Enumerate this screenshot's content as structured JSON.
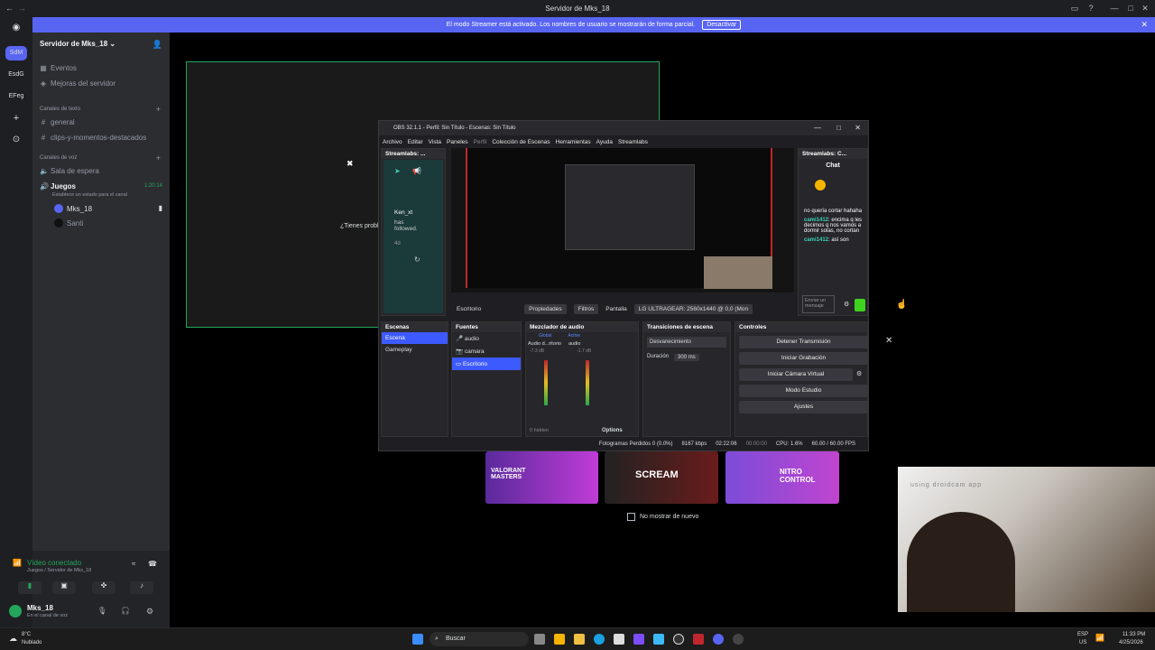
{
  "window": {
    "title": "Servidor de Mks_18"
  },
  "banner": {
    "text": "El modo Streamer está activado. Los nombres de usuario se mostrarán de forma parcial.",
    "button": "Desactivar"
  },
  "guilds": [
    "SdM",
    "EsdG",
    "EFeg"
  ],
  "sidebar": {
    "server_name": "Servidor de Mks_18",
    "events": "Eventos",
    "boosts": "Mejoras del servidor",
    "text_category": "Canales de texto",
    "text_channels": [
      "general",
      "clips-y-momentos-destacados"
    ],
    "voice_category": "Canales de voz",
    "voice_channels": [
      "Sala de espera"
    ],
    "active_voice": {
      "name": "Juegos",
      "time": "1:20:14",
      "status": "Establece un estado para el canal",
      "users": [
        "Mks_18",
        "Santi"
      ]
    }
  },
  "voice_panel": {
    "status": "Vídeo conectado",
    "location": "Juegos / Servidor de Mks_18"
  },
  "user_panel": {
    "name": "Mks_18",
    "status": "En el canal de voz"
  },
  "stream_preview": {
    "prompt": "¿Tienes probl",
    "dont_show": "No mostrar de nuevo"
  },
  "obs": {
    "title": "OBS 32.1.1 - Perfil: Sin Título - Escenas: Sin Título",
    "menu": [
      "Archivo",
      "Editar",
      "Vista",
      "Paneles",
      "Perfil",
      "Colección de Escenas",
      "Herramientas",
      "Ayuda",
      "Streamlabs"
    ],
    "left_dock": {
      "title": "Streamlabs: ...",
      "follow_user": "Ken_xt",
      "follow_text": "has followed.",
      "age": "4d"
    },
    "chat_dock": {
      "title": "Streamlabs: C...",
      "chat": "Chat",
      "lines": [
        {
          "user": "",
          "text": "no quería cortar hahaha"
        },
        {
          "user": "cami1412",
          "text": "encima q les decimos q nos vamos a dormir solas, no cortan"
        },
        {
          "user": "cami1412",
          "text": "así son"
        }
      ],
      "input": "Enviar un mensaje"
    },
    "source_bar": {
      "source": "Escritorio",
      "properties": "Propiedades",
      "filters": "Filtros",
      "display_label": "Pantalla",
      "display": "LG ULTRAGEAR: 2560x1440 @ 0,0 (Mon"
    },
    "scenes": {
      "title": "Escenas",
      "items": [
        "Escena",
        "Gameplay"
      ]
    },
    "sources": {
      "title": "Fuentes",
      "items": [
        "audio",
        "camara",
        "Escritorio"
      ]
    },
    "mixer": {
      "title": "Mezclador de audio",
      "tabs": [
        "Global",
        "Active"
      ],
      "channels": [
        "Audio d...ritorio",
        "audio"
      ],
      "levels": [
        "-7.3 dB",
        "-1.7 dB"
      ],
      "hidden": "0 hidden",
      "options": "Options"
    },
    "transitions": {
      "title": "Transiciones de escena",
      "selected": "Desvanecimiento",
      "duration_label": "Duración",
      "duration": "300 ms"
    },
    "controls": {
      "title": "Controles",
      "buttons": [
        "Detener Transmisión",
        "Iniciar Grabación",
        "Iniciar Cámara Virtual",
        "Modo Estudio",
        "Ajustes"
      ]
    },
    "status": {
      "dropped": "Fotogramas Perdidos 0 (0.0%)",
      "bitrate": "8167 kbps",
      "live": "02:22:06",
      "rec": "00:00:00",
      "cpu": "CPU: 1.6%",
      "fps": "60.00 / 60.00 FPS"
    }
  },
  "promos": [
    "VALORANT MASTERS",
    "SCREAM",
    "NITRO CONTROL"
  ],
  "webcam": {
    "caption": "using droidcam app"
  },
  "taskbar": {
    "weather_temp": "8°C",
    "weather_text": "Nublado",
    "search": "Buscar",
    "lang": "ESP",
    "region": "US",
    "time": "11:33 PM",
    "date": "4/25/2026"
  }
}
